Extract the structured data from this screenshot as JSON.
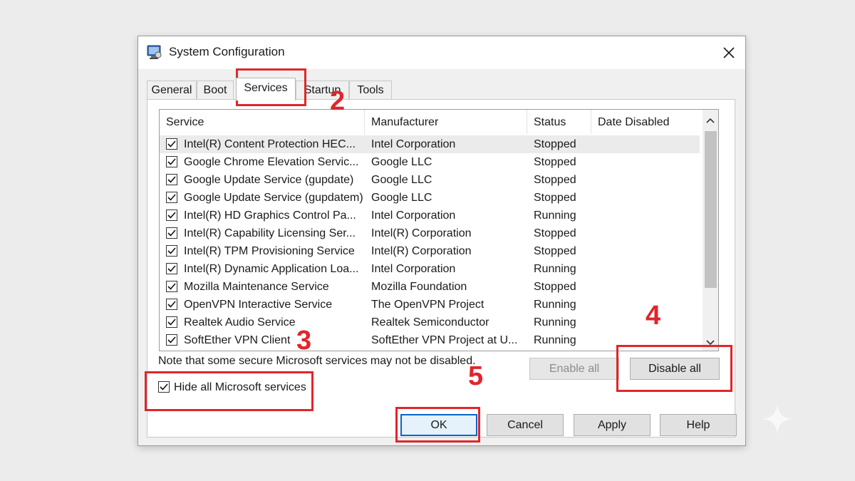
{
  "window": {
    "title": "System Configuration",
    "app_icon": "msconfig-icon",
    "close_icon": "close-icon"
  },
  "tabs": [
    {
      "label": "General",
      "active": false
    },
    {
      "label": "Boot",
      "active": false
    },
    {
      "label": "Services",
      "active": true
    },
    {
      "label": "Startup",
      "active": false
    },
    {
      "label": "Tools",
      "active": false
    }
  ],
  "table": {
    "columns": [
      "Service",
      "Manufacturer",
      "Status",
      "Date Disabled"
    ],
    "rows": [
      {
        "checked": true,
        "service": "Intel(R) Content Protection HEC...",
        "manufacturer": "Intel Corporation",
        "status": "Stopped",
        "date_disabled": ""
      },
      {
        "checked": true,
        "service": "Google Chrome Elevation Servic...",
        "manufacturer": "Google LLC",
        "status": "Stopped",
        "date_disabled": ""
      },
      {
        "checked": true,
        "service": "Google Update Service (gupdate)",
        "manufacturer": "Google LLC",
        "status": "Stopped",
        "date_disabled": ""
      },
      {
        "checked": true,
        "service": "Google Update Service (gupdatem)",
        "manufacturer": "Google LLC",
        "status": "Stopped",
        "date_disabled": ""
      },
      {
        "checked": true,
        "service": "Intel(R) HD Graphics Control Pa...",
        "manufacturer": "Intel Corporation",
        "status": "Running",
        "date_disabled": ""
      },
      {
        "checked": true,
        "service": "Intel(R) Capability Licensing Ser...",
        "manufacturer": "Intel(R) Corporation",
        "status": "Stopped",
        "date_disabled": ""
      },
      {
        "checked": true,
        "service": "Intel(R) TPM Provisioning Service",
        "manufacturer": "Intel(R) Corporation",
        "status": "Stopped",
        "date_disabled": ""
      },
      {
        "checked": true,
        "service": "Intel(R) Dynamic Application Loa...",
        "manufacturer": "Intel Corporation",
        "status": "Running",
        "date_disabled": ""
      },
      {
        "checked": true,
        "service": "Mozilla Maintenance Service",
        "manufacturer": "Mozilla Foundation",
        "status": "Stopped",
        "date_disabled": ""
      },
      {
        "checked": true,
        "service": "OpenVPN Interactive Service",
        "manufacturer": "The OpenVPN Project",
        "status": "Running",
        "date_disabled": ""
      },
      {
        "checked": true,
        "service": "Realtek Audio Service",
        "manufacturer": "Realtek Semiconductor",
        "status": "Running",
        "date_disabled": ""
      },
      {
        "checked": true,
        "service": "SoftEther VPN Client",
        "manufacturer": "SoftEther VPN Project at U...",
        "status": "Running",
        "date_disabled": ""
      }
    ]
  },
  "note": "Note that some secure Microsoft services may not be disabled.",
  "buttons": {
    "enable_all": "Enable all",
    "disable_all": "Disable all",
    "ok": "OK",
    "cancel": "Cancel",
    "apply": "Apply",
    "help": "Help"
  },
  "hide_microsoft": {
    "label": "Hide all Microsoft services",
    "checked": true
  },
  "annotations": [
    "2",
    "3",
    "4",
    "5"
  ],
  "colors": {
    "annotation": "#e0262b",
    "default_button_border": "#0a64c8"
  }
}
